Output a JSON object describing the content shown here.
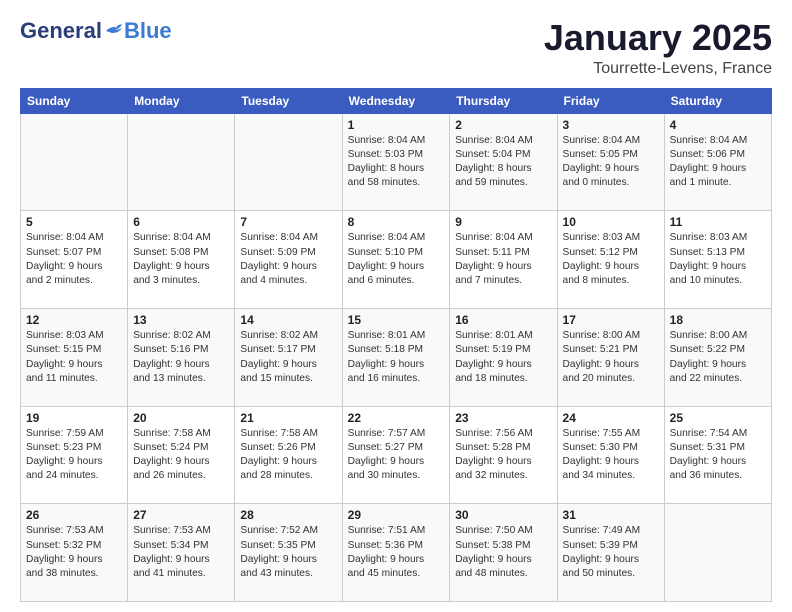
{
  "header": {
    "logo_general": "General",
    "logo_blue": "Blue",
    "month": "January 2025",
    "location": "Tourrette-Levens, France"
  },
  "weekdays": [
    "Sunday",
    "Monday",
    "Tuesday",
    "Wednesday",
    "Thursday",
    "Friday",
    "Saturday"
  ],
  "weeks": [
    [
      {
        "day": "",
        "info": ""
      },
      {
        "day": "",
        "info": ""
      },
      {
        "day": "",
        "info": ""
      },
      {
        "day": "1",
        "info": "Sunrise: 8:04 AM\nSunset: 5:03 PM\nDaylight: 8 hours\nand 58 minutes."
      },
      {
        "day": "2",
        "info": "Sunrise: 8:04 AM\nSunset: 5:04 PM\nDaylight: 8 hours\nand 59 minutes."
      },
      {
        "day": "3",
        "info": "Sunrise: 8:04 AM\nSunset: 5:05 PM\nDaylight: 9 hours\nand 0 minutes."
      },
      {
        "day": "4",
        "info": "Sunrise: 8:04 AM\nSunset: 5:06 PM\nDaylight: 9 hours\nand 1 minute."
      }
    ],
    [
      {
        "day": "5",
        "info": "Sunrise: 8:04 AM\nSunset: 5:07 PM\nDaylight: 9 hours\nand 2 minutes."
      },
      {
        "day": "6",
        "info": "Sunrise: 8:04 AM\nSunset: 5:08 PM\nDaylight: 9 hours\nand 3 minutes."
      },
      {
        "day": "7",
        "info": "Sunrise: 8:04 AM\nSunset: 5:09 PM\nDaylight: 9 hours\nand 4 minutes."
      },
      {
        "day": "8",
        "info": "Sunrise: 8:04 AM\nSunset: 5:10 PM\nDaylight: 9 hours\nand 6 minutes."
      },
      {
        "day": "9",
        "info": "Sunrise: 8:04 AM\nSunset: 5:11 PM\nDaylight: 9 hours\nand 7 minutes."
      },
      {
        "day": "10",
        "info": "Sunrise: 8:03 AM\nSunset: 5:12 PM\nDaylight: 9 hours\nand 8 minutes."
      },
      {
        "day": "11",
        "info": "Sunrise: 8:03 AM\nSunset: 5:13 PM\nDaylight: 9 hours\nand 10 minutes."
      }
    ],
    [
      {
        "day": "12",
        "info": "Sunrise: 8:03 AM\nSunset: 5:15 PM\nDaylight: 9 hours\nand 11 minutes."
      },
      {
        "day": "13",
        "info": "Sunrise: 8:02 AM\nSunset: 5:16 PM\nDaylight: 9 hours\nand 13 minutes."
      },
      {
        "day": "14",
        "info": "Sunrise: 8:02 AM\nSunset: 5:17 PM\nDaylight: 9 hours\nand 15 minutes."
      },
      {
        "day": "15",
        "info": "Sunrise: 8:01 AM\nSunset: 5:18 PM\nDaylight: 9 hours\nand 16 minutes."
      },
      {
        "day": "16",
        "info": "Sunrise: 8:01 AM\nSunset: 5:19 PM\nDaylight: 9 hours\nand 18 minutes."
      },
      {
        "day": "17",
        "info": "Sunrise: 8:00 AM\nSunset: 5:21 PM\nDaylight: 9 hours\nand 20 minutes."
      },
      {
        "day": "18",
        "info": "Sunrise: 8:00 AM\nSunset: 5:22 PM\nDaylight: 9 hours\nand 22 minutes."
      }
    ],
    [
      {
        "day": "19",
        "info": "Sunrise: 7:59 AM\nSunset: 5:23 PM\nDaylight: 9 hours\nand 24 minutes."
      },
      {
        "day": "20",
        "info": "Sunrise: 7:58 AM\nSunset: 5:24 PM\nDaylight: 9 hours\nand 26 minutes."
      },
      {
        "day": "21",
        "info": "Sunrise: 7:58 AM\nSunset: 5:26 PM\nDaylight: 9 hours\nand 28 minutes."
      },
      {
        "day": "22",
        "info": "Sunrise: 7:57 AM\nSunset: 5:27 PM\nDaylight: 9 hours\nand 30 minutes."
      },
      {
        "day": "23",
        "info": "Sunrise: 7:56 AM\nSunset: 5:28 PM\nDaylight: 9 hours\nand 32 minutes."
      },
      {
        "day": "24",
        "info": "Sunrise: 7:55 AM\nSunset: 5:30 PM\nDaylight: 9 hours\nand 34 minutes."
      },
      {
        "day": "25",
        "info": "Sunrise: 7:54 AM\nSunset: 5:31 PM\nDaylight: 9 hours\nand 36 minutes."
      }
    ],
    [
      {
        "day": "26",
        "info": "Sunrise: 7:53 AM\nSunset: 5:32 PM\nDaylight: 9 hours\nand 38 minutes."
      },
      {
        "day": "27",
        "info": "Sunrise: 7:53 AM\nSunset: 5:34 PM\nDaylight: 9 hours\nand 41 minutes."
      },
      {
        "day": "28",
        "info": "Sunrise: 7:52 AM\nSunset: 5:35 PM\nDaylight: 9 hours\nand 43 minutes."
      },
      {
        "day": "29",
        "info": "Sunrise: 7:51 AM\nSunset: 5:36 PM\nDaylight: 9 hours\nand 45 minutes."
      },
      {
        "day": "30",
        "info": "Sunrise: 7:50 AM\nSunset: 5:38 PM\nDaylight: 9 hours\nand 48 minutes."
      },
      {
        "day": "31",
        "info": "Sunrise: 7:49 AM\nSunset: 5:39 PM\nDaylight: 9 hours\nand 50 minutes."
      },
      {
        "day": "",
        "info": ""
      }
    ]
  ]
}
